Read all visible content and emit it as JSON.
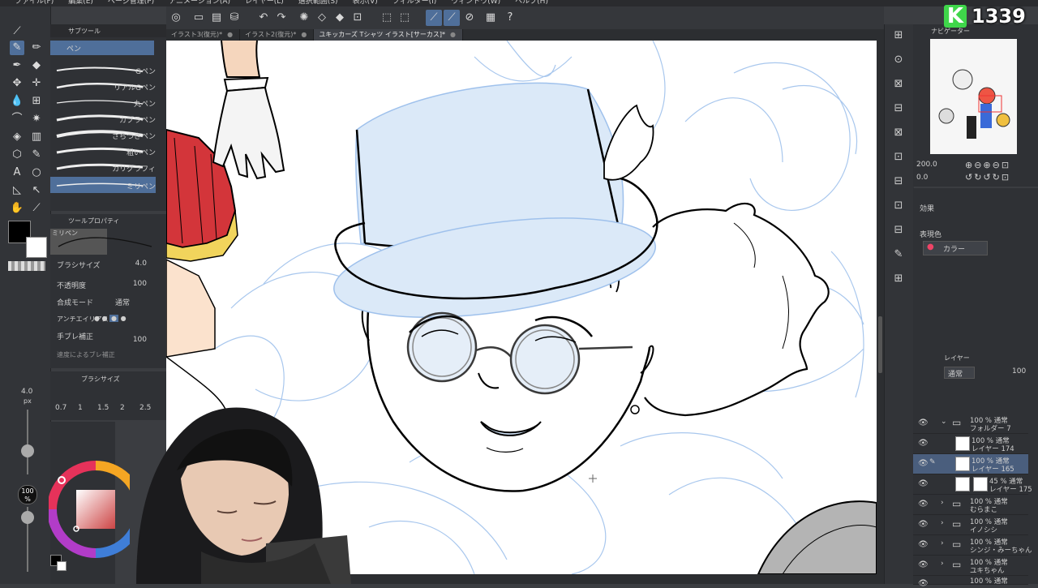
{
  "menu": [
    "ファイル(F)",
    "編集(E)",
    "ページ管理(P)",
    "アニメーション(A)",
    "レイヤー(L)",
    "選択範囲(S)",
    "表示(V)",
    "フィルター(I)",
    "ウィンドウ(W)",
    "ヘルプ(H)"
  ],
  "tabs": [
    {
      "label": "イラスト3(復元)*",
      "active": false
    },
    {
      "label": "イラスト2(復元)*",
      "active": false
    },
    {
      "label": "ユキッカーズ Tシャツ イラスト[サーカス]*",
      "active": true
    }
  ],
  "subtool": {
    "title": "サブツール",
    "selected_label": "ペン",
    "brushes": [
      "Gペン",
      "リアルGペン",
      "丸ペン",
      "カブラペン",
      "さらつきペン",
      "粗いペン",
      "カリグラフィ",
      "ミリペン"
    ],
    "selected_brush": "ミリペン"
  },
  "tool_property": {
    "title": "ツールプロパティ",
    "preset": "ミリペン",
    "brush_size_label": "ブラシサイズ",
    "brush_size_value": "4.0",
    "opacity_label": "不透明度",
    "opacity_value": "100",
    "blend_label": "合成モード",
    "blend_value": "通常",
    "antialias_label": "アンチエイリアス",
    "stabilization_label": "手ブレ補正",
    "stabilization_value": "100",
    "extra_label": "速度によるブレ補正"
  },
  "brush_size_panel": {
    "title": "ブラシサイズ",
    "sizes": [
      "0.7",
      "1",
      "1.5",
      "2",
      "2.5"
    ],
    "current_size": "4.0",
    "current_unit": "px",
    "opacity_pct": "100",
    "opacity_unit": "%"
  },
  "navigator": {
    "title": "ナビゲーター",
    "zoom": "200.0",
    "rotation": "0.0"
  },
  "effect": {
    "title": "効果",
    "expression_label": "表現色",
    "expression_value": "カラー"
  },
  "layer_panel": {
    "title": "レイヤー",
    "blend": "通常",
    "opacity": "100",
    "layers": [
      {
        "line1": "100 % 通常",
        "line2": "フォルダー 7",
        "type": "folder",
        "expanded": true,
        "selected": false,
        "indent": 0
      },
      {
        "line1": "100 % 通常",
        "line2": "レイヤー 174",
        "type": "layer",
        "selected": false,
        "indent": 1
      },
      {
        "line1": "100 % 通常",
        "line2": "レイヤー 165",
        "type": "layer",
        "selected": true,
        "indent": 1
      },
      {
        "line1": "45 % 通常",
        "line2": "レイヤー 175",
        "type": "layer",
        "selected": false,
        "indent": 1
      },
      {
        "line1": "100 % 通常",
        "line2": "むらまこ",
        "type": "folder",
        "expanded": false,
        "selected": false,
        "indent": 0
      },
      {
        "line1": "100 % 通常",
        "line2": "イノシシ",
        "type": "folder",
        "expanded": false,
        "selected": false,
        "indent": 0
      },
      {
        "line1": "100 % 通常",
        "line2": "シンジ・みーちゃん",
        "type": "folder",
        "expanded": false,
        "selected": false,
        "indent": 0
      },
      {
        "line1": "100 % 通常",
        "line2": "ユキちゃん",
        "type": "folder",
        "expanded": false,
        "selected": false,
        "indent": 0
      },
      {
        "line1": "100 % 通常",
        "line2": "",
        "type": "folder",
        "expanded": false,
        "selected": false,
        "indent": 0
      }
    ]
  },
  "badge": {
    "letter": "K",
    "count": "1339",
    "color": "#3fd64a"
  },
  "colors": {
    "main": "#000000",
    "sub": "#ffffff",
    "accent": "#4f6f9a",
    "sketch_blue": "#8fb6e8"
  }
}
